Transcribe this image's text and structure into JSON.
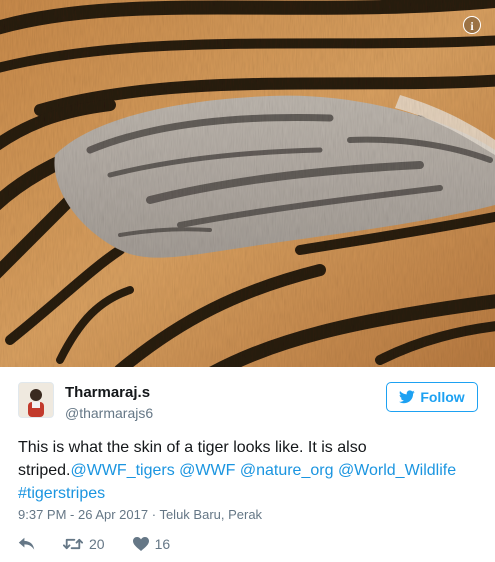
{
  "photo": {
    "info_icon": "info-icon",
    "info_glyph": "i"
  },
  "user": {
    "name": "Tharmaraj.s",
    "handle": "@tharmarajs6",
    "avatar_icon": "avatar"
  },
  "follow": {
    "label": "Follow",
    "icon": "twitter-bird-icon",
    "color": "#1da1f2"
  },
  "tweet": {
    "text_plain": "This is what the skin of a tiger looks like. It is also striped.",
    "mentions": [
      "@WWF_tigers",
      "@WWF",
      "@nature_org",
      "@World_Wildlife"
    ],
    "hashtag": "#tigerstripes",
    "link_color": "#1b95e0"
  },
  "meta": {
    "time": "9:37 PM - 26 Apr 2017",
    "separator": "·",
    "location": "Teluk Baru, Perak"
  },
  "actions": {
    "reply_icon": "reply-icon",
    "retweet_icon": "retweet-icon",
    "retweet_count": "20",
    "like_icon": "heart-icon",
    "like_count": "16"
  }
}
